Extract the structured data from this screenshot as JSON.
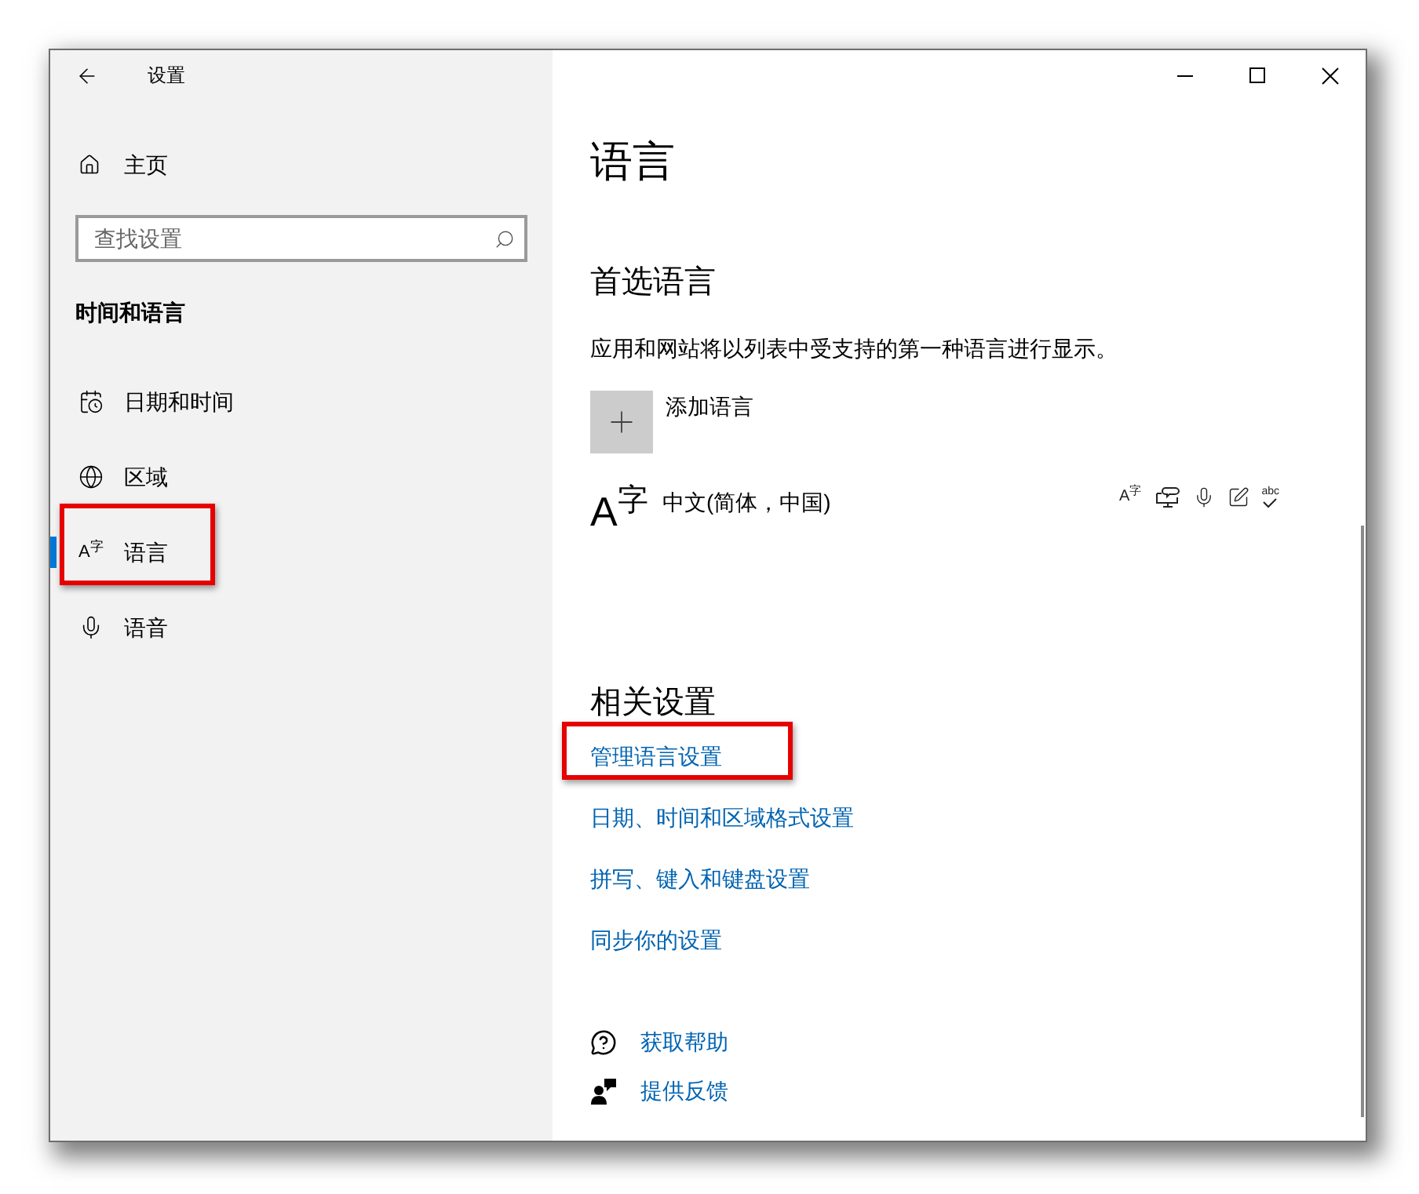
{
  "window": {
    "title": "设置"
  },
  "sidebar": {
    "home": "主页",
    "search": {
      "placeholder": "查找设置"
    },
    "section_title": "时间和语言",
    "items": [
      {
        "label": "日期和时间",
        "selected": false,
        "annotated": false
      },
      {
        "label": "区域",
        "selected": false,
        "annotated": false
      },
      {
        "label": "语言",
        "glyph": "A$^{字}$",
        "selected": true,
        "annotated": true
      },
      {
        "label": "语音",
        "selected": false,
        "annotated": false
      }
    ]
  },
  "content": {
    "title": "语言",
    "preferred": {
      "heading": "首选语言",
      "description": "应用和网站将以列表中受支持的第一种语言进行显示。",
      "add_label": "添加语言",
      "languages": [
        {
          "name": "中文(简体，中国)",
          "glyph": "A$^{字}$",
          "features": [
            {
              "kind": "glyph",
              "text": "A$^{字}$"
            },
            {
              "kind": "speech"
            },
            {
              "kind": "microphone"
            },
            {
              "kind": "handwriting"
            },
            {
              "kind": "spelling",
              "text": "abc"
            }
          ]
        }
      ]
    },
    "related": {
      "heading": "相关设置",
      "links": [
        {
          "label": "管理语言设置",
          "annotated": true
        },
        {
          "label": "日期、时间和区域格式设置",
          "annotated": false
        },
        {
          "label": "拼写、键入和键盘设置",
          "annotated": false
        },
        {
          "label": "同步你的设置",
          "annotated": false
        }
      ]
    },
    "support": [
      {
        "label": "获取帮助"
      },
      {
        "label": "提供反馈"
      }
    ]
  }
}
